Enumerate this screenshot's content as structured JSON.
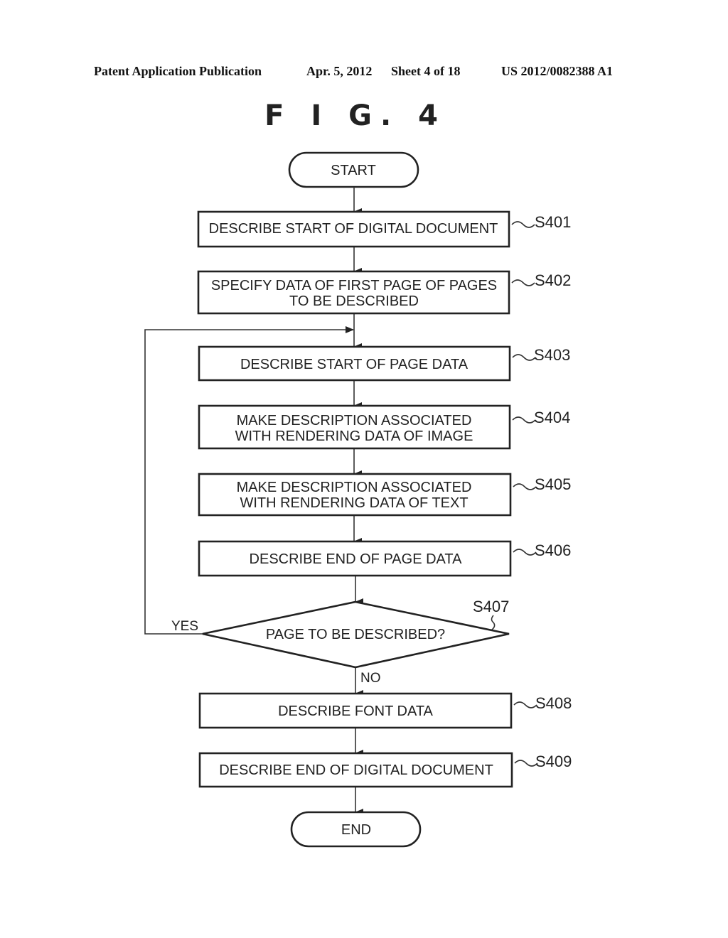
{
  "header": {
    "publication": "Patent Application Publication",
    "date": "Apr. 5, 2012",
    "sheet": "Sheet 4 of 18",
    "number": "US 2012/0082388 A1"
  },
  "figure": {
    "title": "F I G. 4"
  },
  "flowchart": {
    "start": "START",
    "end": "END",
    "steps": [
      {
        "id": "S401",
        "lines": [
          "DESCRIBE START OF DIGITAL DOCUMENT"
        ]
      },
      {
        "id": "S402",
        "lines": [
          "SPECIFY DATA OF FIRST PAGE OF PAGES",
          "TO BE DESCRIBED"
        ]
      },
      {
        "id": "S403",
        "lines": [
          "DESCRIBE START OF PAGE DATA"
        ]
      },
      {
        "id": "S404",
        "lines": [
          "MAKE DESCRIPTION ASSOCIATED",
          "WITH RENDERING DATA OF IMAGE"
        ]
      },
      {
        "id": "S405",
        "lines": [
          "MAKE DESCRIPTION ASSOCIATED",
          "WITH RENDERING DATA OF TEXT"
        ]
      },
      {
        "id": "S406",
        "lines": [
          "DESCRIBE END OF PAGE DATA"
        ]
      },
      {
        "id": "S408",
        "lines": [
          "DESCRIBE FONT DATA"
        ]
      },
      {
        "id": "S409",
        "lines": [
          "DESCRIBE END OF DIGITAL DOCUMENT"
        ]
      }
    ],
    "decision": {
      "id": "S407",
      "question": "PAGE TO BE DESCRIBED?",
      "yes_label": "YES",
      "no_label": "NO"
    }
  }
}
